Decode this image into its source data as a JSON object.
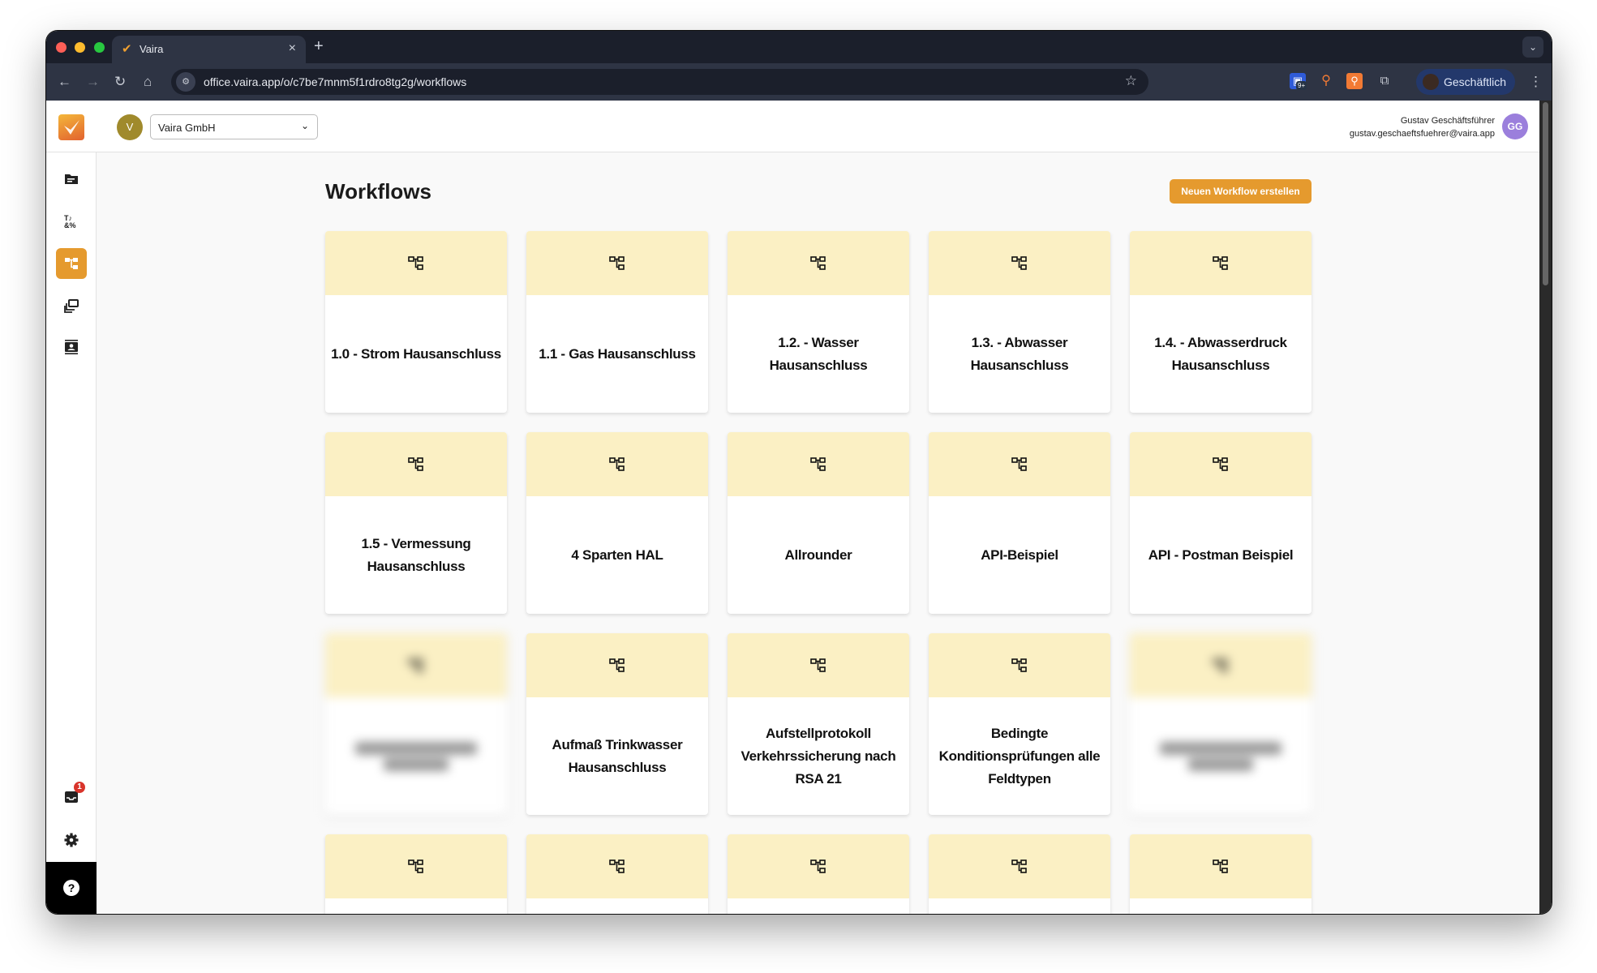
{
  "browser": {
    "tab_title": "Vaira",
    "url": "office.vaira.app/o/c7be7mnm5f1rdro8tg2g/workflows",
    "profile_label": "Geschäftlich",
    "extension_badge": "9+"
  },
  "header": {
    "org_initial": "V",
    "org_name": "Vaira GmbH",
    "user_name": "Gustav Geschäftsführer",
    "user_email": "gustav.geschaeftsfuehrer@vaira.app",
    "user_initials": "GG"
  },
  "sidebar": {
    "items": [
      {
        "name": "documents",
        "active": false
      },
      {
        "name": "formulas",
        "active": false
      },
      {
        "name": "workflows",
        "active": true
      },
      {
        "name": "templates",
        "active": false
      },
      {
        "name": "contacts",
        "active": false
      }
    ],
    "inbox_badge": "1",
    "help_label": "?"
  },
  "main": {
    "title": "Workflows",
    "new_button": "Neuen Workflow erstellen",
    "workflows": [
      "1.0 - Strom Hausanschluss",
      "1.1 - Gas Hausanschluss",
      "1.2. - Wasser Hausanschluss",
      "1.3. - Abwasser Hausanschluss",
      "1.4. - Abwasserdruck Hausanschluss",
      "1.5 - Vermessung Hausanschluss",
      "4 Sparten HAL",
      "Allrounder",
      "API-Beispiel",
      "API - Postman Beispiel",
      "",
      "Aufmaß Trinkwasser Hausanschluss",
      "Aufstellprotokoll Verkehrssicherung nach RSA 21",
      "Bedingte Konditionsprüfungen alle Feldtypen",
      "",
      "",
      "",
      "",
      "",
      ""
    ]
  },
  "colors": {
    "accent": "#e59a2e",
    "card_header": "#fbf0c4"
  }
}
